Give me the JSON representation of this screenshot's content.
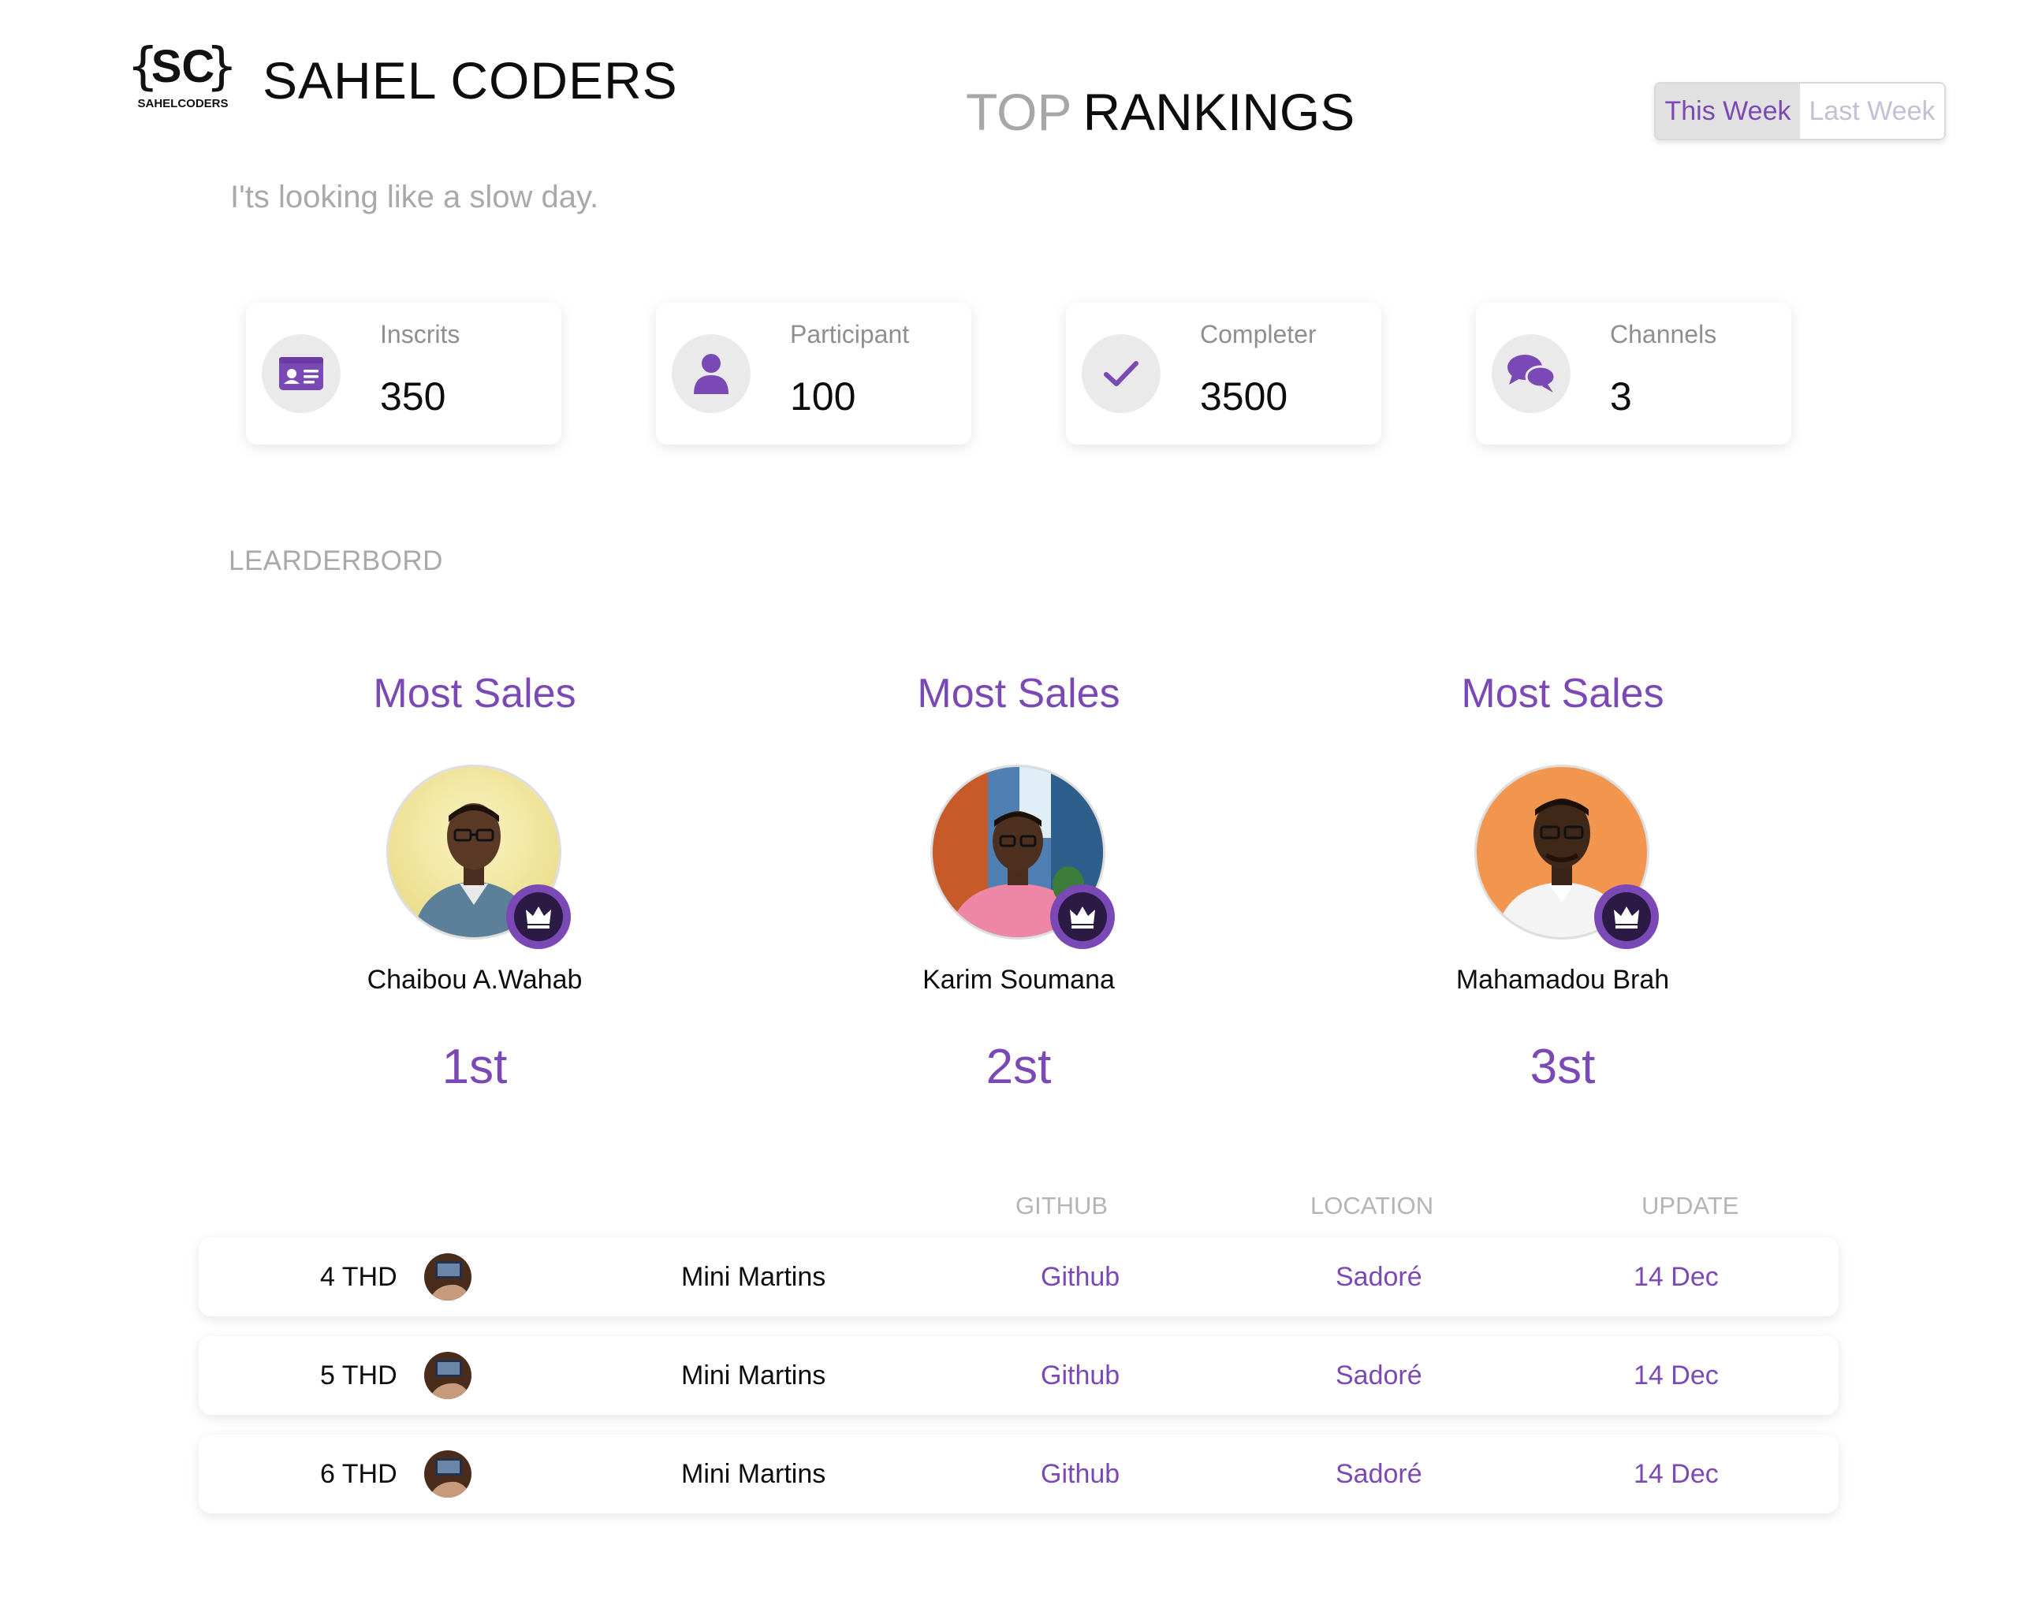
{
  "header": {
    "logo_text": "SC",
    "logo_sub": "SAHELCODERS",
    "brand": "SAHEL CODERS",
    "title_muted": "TOP",
    "title_dark": "RANKINGS",
    "subtitle": "I'ts looking like a slow day."
  },
  "week_toggle": {
    "this_week": "This Week",
    "last_week": "Last Week",
    "selected": "This Week"
  },
  "stats": [
    {
      "label": "Inscrits",
      "value": "350",
      "icon": "id-card-icon"
    },
    {
      "label": "Participant",
      "value": "100",
      "icon": "user-icon"
    },
    {
      "label": "Completer",
      "value": "3500",
      "icon": "check-icon"
    },
    {
      "label": "Channels",
      "value": "3",
      "icon": "chat-bubbles-icon"
    }
  ],
  "leaderboard": {
    "label": "LEARDERBORD",
    "podium": [
      {
        "heading": "Most Sales",
        "name": "Chaibou A.Wahab",
        "rank": "1st"
      },
      {
        "heading": "Most Sales",
        "name": "Karim Soumana",
        "rank": "2st"
      },
      {
        "heading": "Most Sales",
        "name": "Mahamadou Brah",
        "rank": "3st"
      }
    ]
  },
  "table": {
    "headers": {
      "github": "GITHUB",
      "location": "LOCATION",
      "update": "UPDATE"
    },
    "rows": [
      {
        "rank": "4 THD",
        "name": "Mini Martins",
        "github": "Github",
        "location": "Sadoré",
        "update": "14 Dec"
      },
      {
        "rank": "5 THD",
        "name": "Mini Martins",
        "github": "Github",
        "location": "Sadoré",
        "update": "14 Dec"
      },
      {
        "rank": "6 THD",
        "name": "Mini Martins",
        "github": "Github",
        "location": "Sadoré",
        "update": "14 Dec"
      }
    ]
  },
  "colors": {
    "accent": "#7a49b5",
    "muted": "#a9a9a9",
    "text": "#0d0d0d"
  }
}
